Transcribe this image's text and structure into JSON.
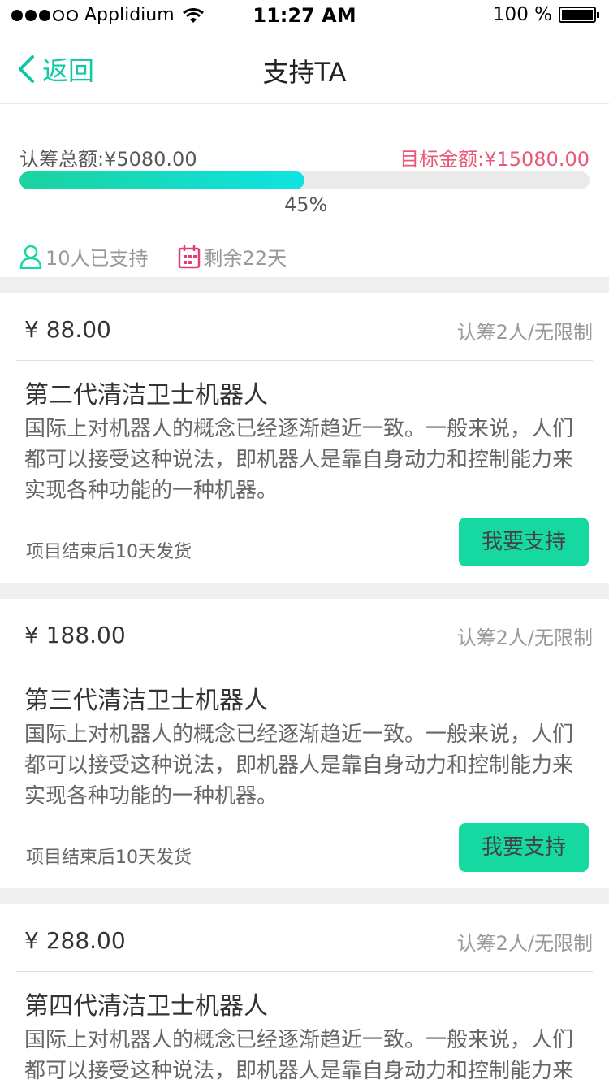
{
  "status_bar": {
    "carrier": "Applidium",
    "time": "11:27 AM",
    "battery": "100 %"
  },
  "nav": {
    "back_label": "返回",
    "title": "支持TA"
  },
  "summary": {
    "raised_label": "认筹总额:¥5080.00",
    "target_label": "目标金额:¥15080.00",
    "progress_fraction": 0.5,
    "percent_label": "45%",
    "supporters_label": "10人已支持",
    "remaining_label": "剩余22天"
  },
  "rewards": [
    {
      "price": "¥ 88.00",
      "quota": "认筹2人/无限制",
      "title": "第二代清洁卫士机器人",
      "description": "国际上对机器人的概念已经逐渐趋近一致。一般来说，人们都可以接受这种说法，即机器人是靠自身动力和控制能力来实现各种功能的一种机器。",
      "shipping": "项目结束后10天发货",
      "button": "我要支持"
    },
    {
      "price": "¥ 188.00",
      "quota": "认筹2人/无限制",
      "title": "第三代清洁卫士机器人",
      "description": "国际上对机器人的概念已经逐渐趋近一致。一般来说，人们都可以接受这种说法，即机器人是靠自身动力和控制能力来实现各种功能的一种机器。",
      "shipping": "项目结束后10天发货",
      "button": "我要支持"
    },
    {
      "price": "¥ 288.00",
      "quota": "认筹2人/无限制",
      "title": "第四代清洁卫士机器人",
      "description": "国际上对机器人的概念已经逐渐趋近一致。一般来说，人们都可以接受这种说法，即机器人是靠自身动力和控制能力来",
      "shipping": "",
      "button": ""
    }
  ],
  "colors": {
    "accent": "#15d9a0",
    "target": "#e9587a",
    "calendar_icon": "#e0407a"
  },
  "icons": {
    "back": "chevron-left-icon",
    "supporters": "person-icon",
    "remaining": "calendar-icon"
  }
}
